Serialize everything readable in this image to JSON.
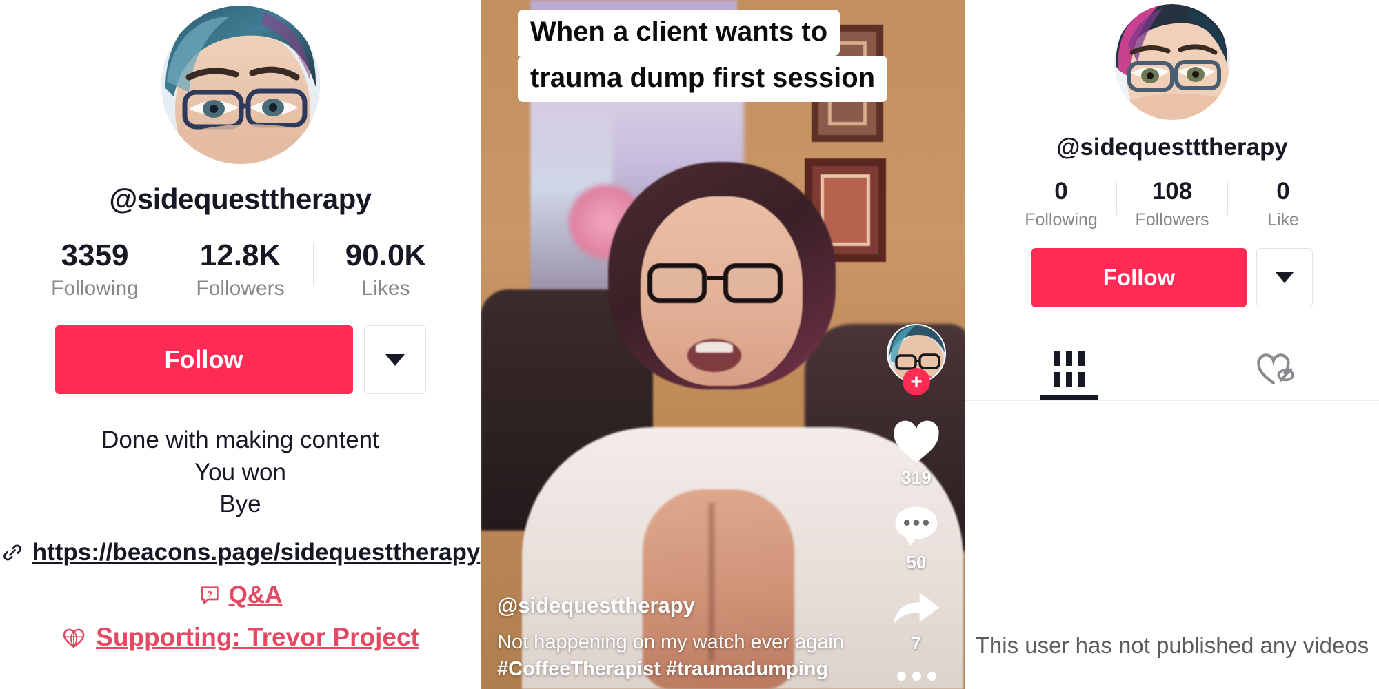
{
  "left_profile": {
    "username": "@sidequesttherapy",
    "avatar": "profile-photo-woman-with-glasses",
    "stats": [
      {
        "value": "3359",
        "label": "Following"
      },
      {
        "value": "12.8K",
        "label": "Followers"
      },
      {
        "value": "90.0K",
        "label": "Likes"
      }
    ],
    "follow_label": "Follow",
    "more_icon": "chevron-down-icon",
    "bio_lines": [
      "Done with making content",
      "You won",
      "Bye"
    ],
    "link": {
      "icon": "link-icon",
      "text": "https://beacons.page/sidequesttherapy"
    },
    "qa": {
      "icon": "question-box-icon",
      "text": "Q&A"
    },
    "supporting": {
      "icon": "globe-heart-icon",
      "text": "Supporting: Trevor Project"
    },
    "accent_color": "#fe2c55",
    "link_accent_color": "#e24a63"
  },
  "video": {
    "caption_lines": [
      "When a client wants to",
      "trauma dump first session"
    ],
    "author_handle": "@sidequesttherapy",
    "description": "Not happening on my watch ever again",
    "hashtags": "#CoffeeTherapist #traumadumping",
    "rail": {
      "avatar": "creator-avatar",
      "follow_badge": "plus-icon",
      "like": {
        "icon": "heart-icon",
        "count": "319"
      },
      "comment": {
        "icon": "comment-bubble-icon",
        "count": "50"
      },
      "share": {
        "icon": "share-arrow-icon",
        "count": "7"
      },
      "more": {
        "icon": "more-dots-icon"
      }
    }
  },
  "right_profile": {
    "username": "@sidequestttherapy",
    "avatar": "profile-photo-woman-with-glasses",
    "stats": [
      {
        "value": "0",
        "label": "Following"
      },
      {
        "value": "108",
        "label": "Followers"
      },
      {
        "value": "0",
        "label": "Like"
      }
    ],
    "follow_label": "Follow",
    "more_icon": "chevron-down-icon",
    "tabs": [
      {
        "icon": "grid-videos-icon",
        "active": true
      },
      {
        "icon": "liked-hidden-heart-icon",
        "active": false
      }
    ],
    "empty_message": "This user has not published any videos",
    "accent_color": "#fe2c55"
  }
}
